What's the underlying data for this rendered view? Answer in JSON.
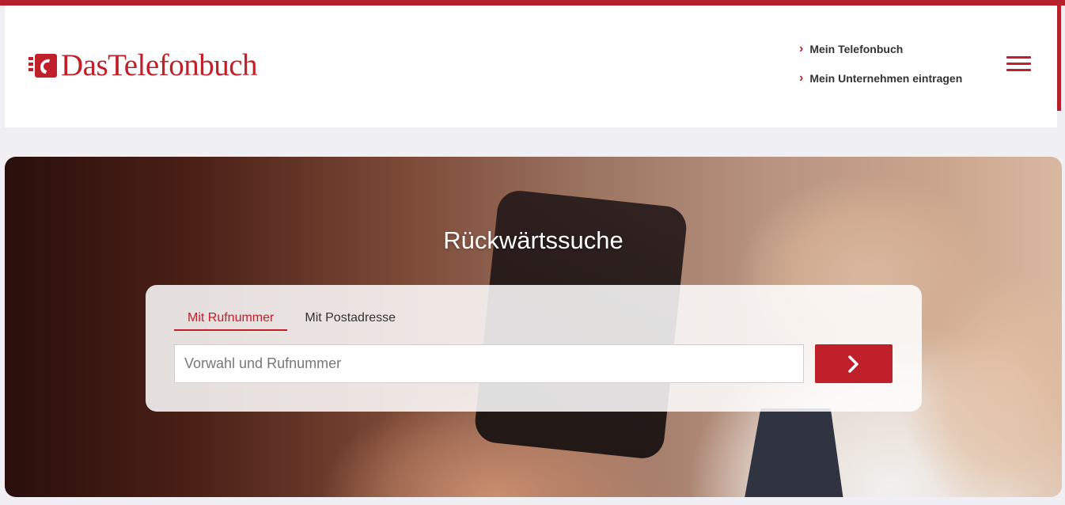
{
  "header": {
    "logo_text": "DasTelefonbuch",
    "links": [
      "Mein Telefonbuch",
      "Mein Unternehmen eintragen"
    ],
    "link_icon": "chevron-right-icon",
    "menu_icon": "hamburger-menu-icon"
  },
  "hero": {
    "title": "Rückwärtssuche"
  },
  "search": {
    "tabs": [
      "Mit Rufnummer",
      "Mit Postadresse"
    ],
    "active_tab": "Mit Rufnummer",
    "placeholder": "Vorwahl und Rufnummer",
    "value": "",
    "submit_icon": "chevron-right-icon"
  },
  "colors": {
    "brand_red": "#c0202a",
    "page_background": "#efeff4",
    "header_background": "#ffffff"
  }
}
